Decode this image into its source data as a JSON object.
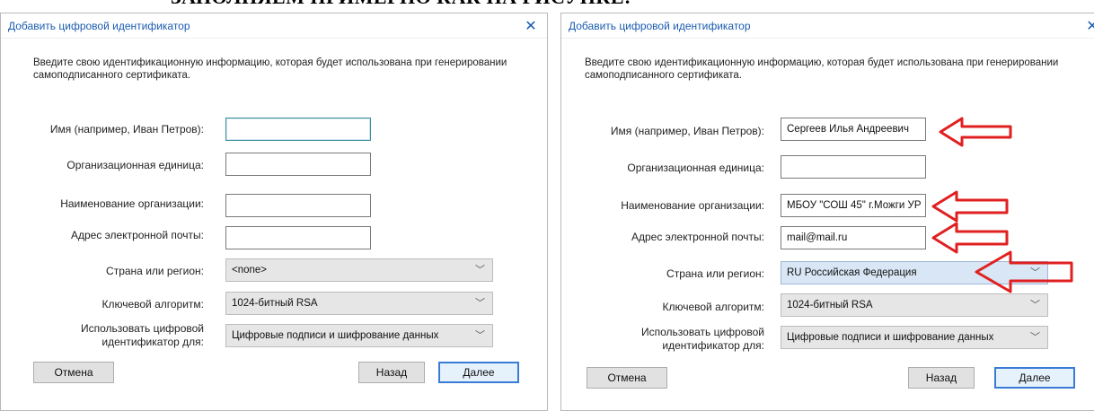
{
  "page_heading": "ЗАПОЛНЯЕМ ПРИМЕРНО КАК НА РИСУНКЕ:",
  "dialogs": [
    {
      "title": "Добавить цифровой идентификатор",
      "close_icon": "close-icon",
      "description": "Введите свою идентификационную информацию, которая будет использована при генерировании самоподписанного сертификата.",
      "labels": {
        "name": "Имя (например, Иван Петров):",
        "org_unit": "Организационная единица:",
        "org_name": "Наименование организации:",
        "email": "Адрес электронной почты:",
        "country": "Страна или регион:",
        "algorithm": "Ключевой алгоритм:",
        "usage_line1": "Использовать цифровой",
        "usage_line2": "идентификатор для:"
      },
      "values": {
        "name": "",
        "org_unit": "",
        "org_name": "",
        "email": "",
        "country": "<none>",
        "algorithm": "1024-битный RSA",
        "usage": "Цифровые подписи и шифрование данных"
      },
      "buttons": {
        "cancel": "Отмена",
        "back": "Назад",
        "next": "Далее"
      }
    },
    {
      "title": "Добавить цифровой идентификатор",
      "close_icon": "close-icon",
      "description": "Введите свою идентификационную информацию, которая будет использована при генерировании самоподписанного сертификата.",
      "labels": {
        "name": "Имя (например, Иван Петров):",
        "org_unit": "Организационная единица:",
        "org_name": "Наименование организации:",
        "email": "Адрес электронной почты:",
        "country": "Страна или регион:",
        "algorithm": "Ключевой алгоритм:",
        "usage_line1": "Использовать цифровой",
        "usage_line2": "идентификатор для:"
      },
      "values": {
        "name": "Сергеев Илья Андреевич",
        "org_unit": "",
        "org_name": "МБОУ \"СОШ 45\" г.Можги УР",
        "email": "mail@mail.ru",
        "country": "RU Российская Федерация",
        "algorithm": "1024-битный RSA",
        "usage": "Цифровые подписи и шифрование данных"
      },
      "buttons": {
        "cancel": "Отмена",
        "back": "Назад",
        "next": "Далее"
      }
    }
  ],
  "colors": {
    "title_text": "#1a5bb0",
    "arrow": "#e02020",
    "focus_border": "#3c8f9b",
    "primary_border": "#3a7bd5"
  },
  "icons": {
    "dropdown": "chevron-down-icon",
    "pointer": "red-arrow-icon"
  }
}
